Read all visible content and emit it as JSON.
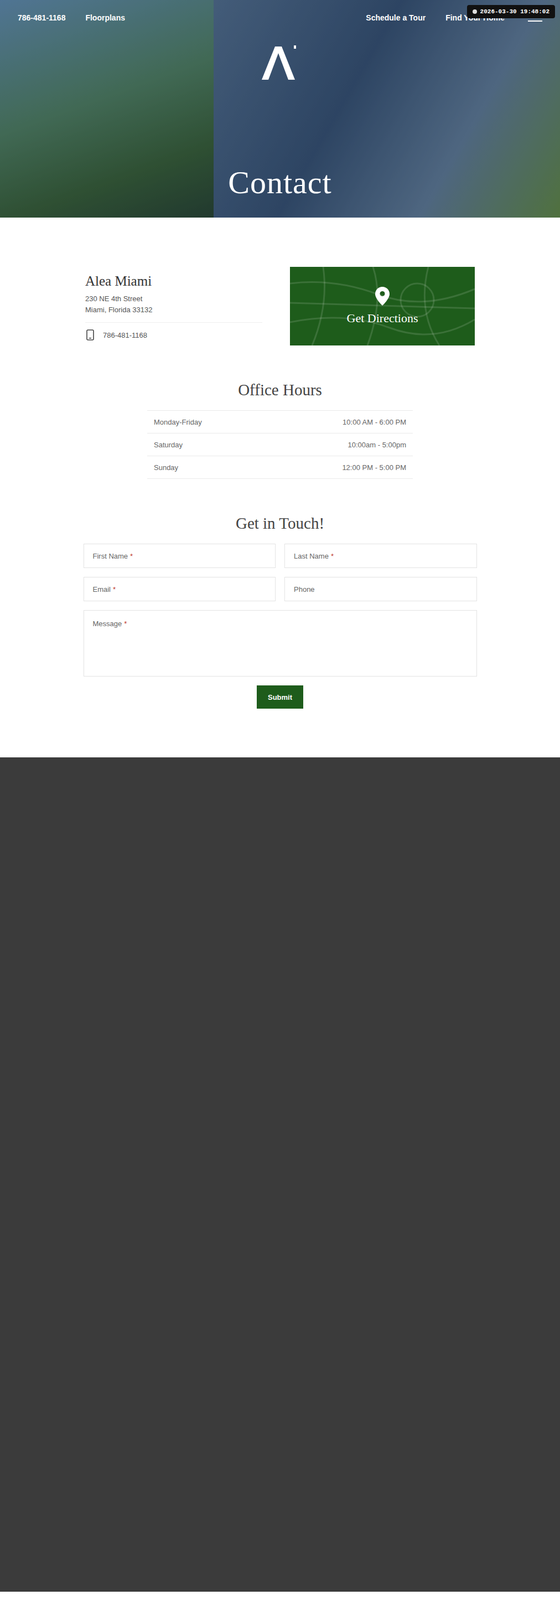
{
  "timestamp": "2026-03-30 19:48:02",
  "nav": {
    "phone": "786-481-1168",
    "left_links": [
      "Floorplans"
    ],
    "right_links": [
      "Schedule a Tour",
      "Find Your Home"
    ]
  },
  "hero": {
    "title": "Contact"
  },
  "property": {
    "name": "Alea Miami",
    "address": [
      "230 NE 4th Street",
      "Miami, Florida 33132"
    ],
    "phone": "786-481-1168"
  },
  "directions": {
    "label": "Get Directions"
  },
  "office_hours": {
    "title": "Office Hours",
    "rows": [
      {
        "day": "Monday-Friday",
        "hours": "10:00 AM - 6:00 PM"
      },
      {
        "day": "Saturday",
        "hours": "10:00am - 5:00pm"
      },
      {
        "day": "Sunday",
        "hours": "12:00 PM - 5:00 PM"
      }
    ]
  },
  "form": {
    "title": "Get in Touch!",
    "required_mark": "*",
    "fields": [
      {
        "placeholder": "First Name",
        "required": true,
        "kind": "input"
      },
      {
        "placeholder": "Last Name",
        "required": true,
        "kind": "input"
      },
      {
        "placeholder": "Email",
        "required": true,
        "kind": "input"
      },
      {
        "placeholder": "Phone",
        "required": false,
        "kind": "input"
      },
      {
        "placeholder": "Message",
        "required": true,
        "kind": "textarea"
      }
    ],
    "submit": "Submit"
  }
}
